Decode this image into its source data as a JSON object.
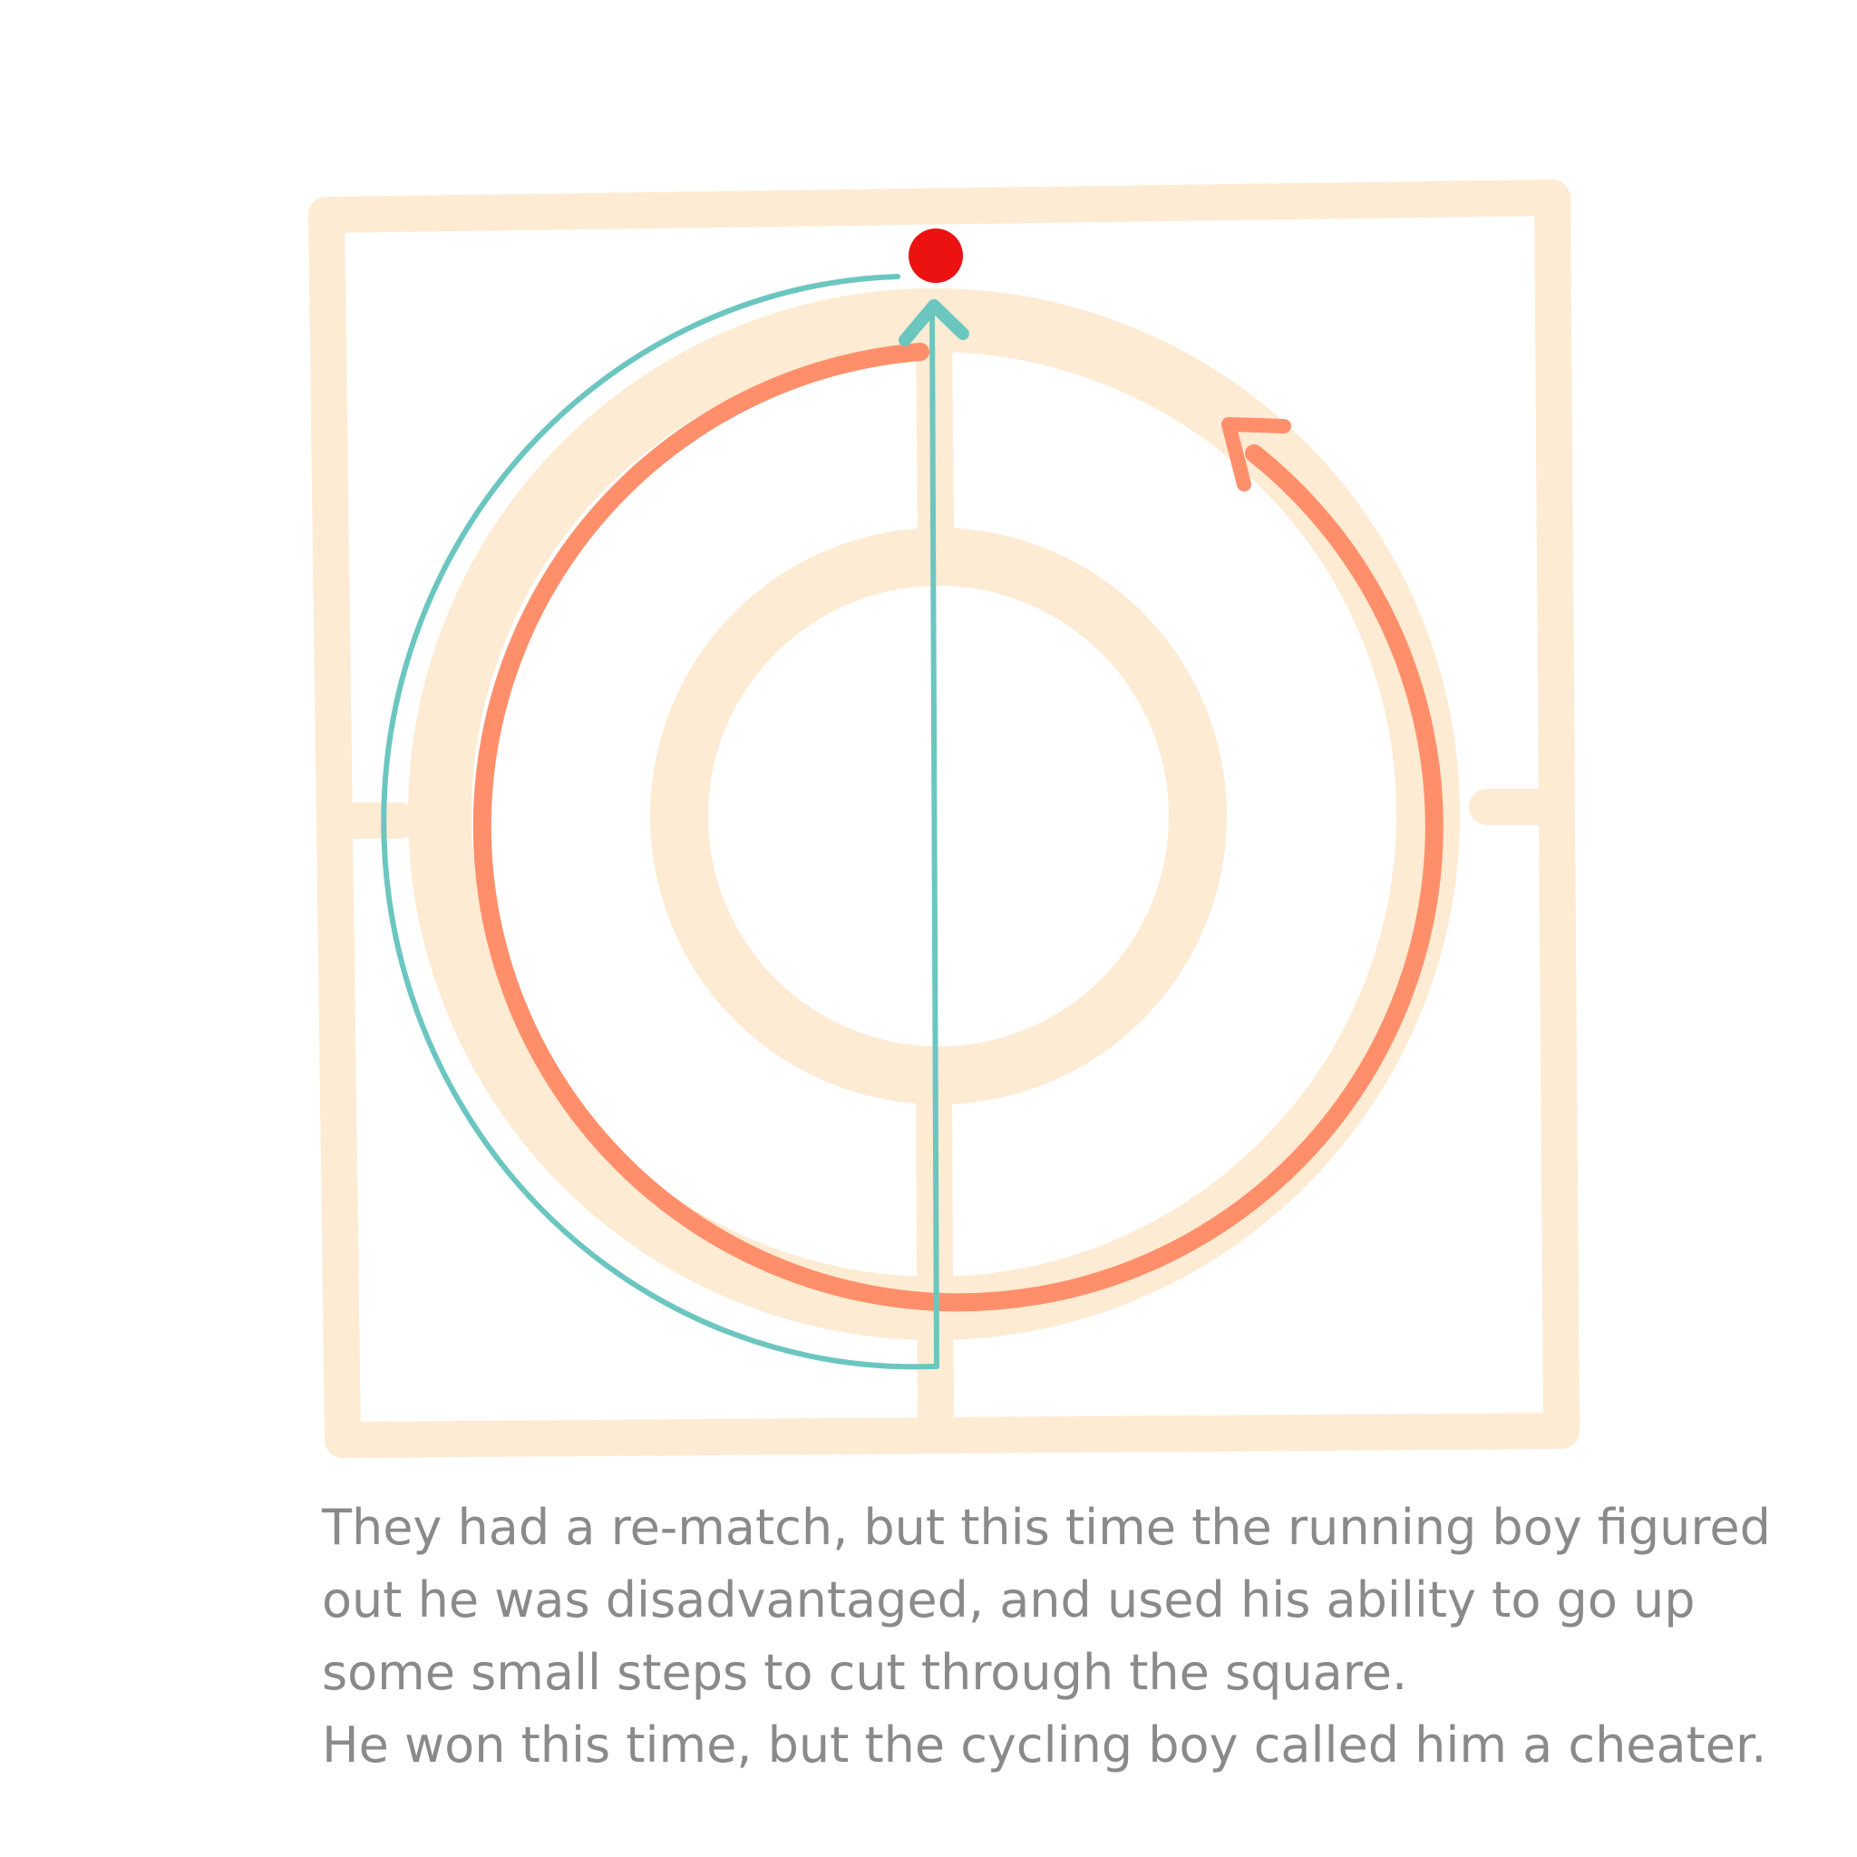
{
  "colors": {
    "track": "#fdebd3",
    "cyclist_path": "#ff8f6b",
    "runner_path": "#6cc6c0",
    "finish_dot": "#ec1212",
    "caption": "#8a8a8a",
    "background": "#ffffff"
  },
  "caption": {
    "lines": [
      "They had a re-match, but this time the running boy figured",
      "out he was disadvantaged, and used his ability to go up",
      "some small steps to cut through the square.",
      "He won this time, but the cycling boy called him a cheater."
    ]
  }
}
